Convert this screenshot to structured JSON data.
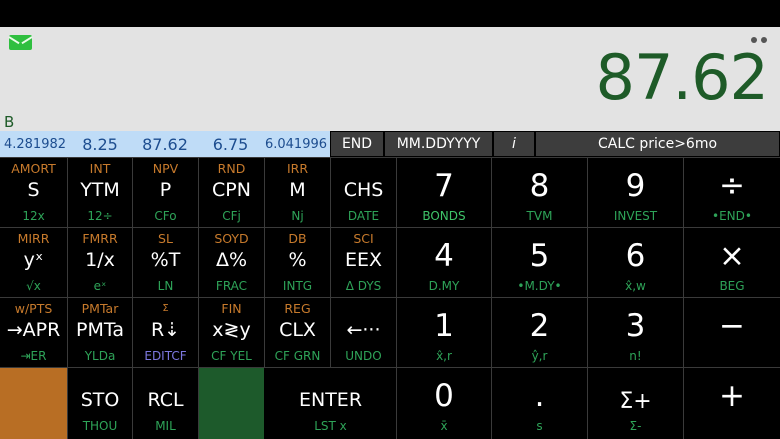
{
  "display": {
    "value": "87.62",
    "mode": "B",
    "message_icon": "envelope-icon",
    "menu_icon": "more-dots-icon"
  },
  "status": {
    "registers": [
      "4.281982",
      "8.25",
      "87.62",
      "6.75",
      "6.041996"
    ],
    "end_mode": "END",
    "date_format": "MM.DDYYYY",
    "i_label": "i",
    "calc_label": "CALC price>6mo"
  },
  "keys": {
    "amort": {
      "top": "AMORT",
      "main": "S",
      "bottom": "12x"
    },
    "int": {
      "top": "INT",
      "main": "YTM",
      "bottom": "12÷"
    },
    "npv": {
      "top": "NPV",
      "main": "P",
      "bottom": "CFo"
    },
    "rnd": {
      "top": "RND",
      "main": "CPN",
      "bottom": "CFj"
    },
    "irr": {
      "top": "IRR",
      "main": "M",
      "bottom": "Nj"
    },
    "chs": {
      "main": "CHS",
      "bottom": "DATE"
    },
    "seven": {
      "main": "7",
      "bottom": "BONDS"
    },
    "eight": {
      "main": "8",
      "bottom": "TVM"
    },
    "nine": {
      "main": "9",
      "bottom": "INVEST"
    },
    "divide": {
      "main": "÷",
      "bottom": "•END•"
    },
    "mirr": {
      "top": "MIRR",
      "main": "yˣ",
      "bottom": "√x"
    },
    "fmrr": {
      "top": "FMRR",
      "main": "1/x",
      "bottom": "eˣ"
    },
    "sl": {
      "top": "SL",
      "main": "%T",
      "bottom": "LN"
    },
    "soyd": {
      "top": "SOYD",
      "main": "Δ%",
      "bottom": "FRAC"
    },
    "db": {
      "top": "DB",
      "main": "%",
      "bottom": "INTG"
    },
    "sci": {
      "top": "SCI",
      "main": "EEX",
      "bottom": "Δ DYS"
    },
    "four": {
      "main": "4",
      "bottom": "D.MY"
    },
    "five": {
      "main": "5",
      "bottom": "•M.DY•"
    },
    "six": {
      "main": "6",
      "bottom": "x̂,w"
    },
    "multiply": {
      "main": "×",
      "bottom": "BEG"
    },
    "wpts": {
      "top": "w/PTS",
      "main": "→APR",
      "bottom": "⇥ER"
    },
    "pmtar": {
      "top": "PMTar",
      "main": "PMTa",
      "bottom": "YLDa"
    },
    "sigma_top": {
      "top": "Σ",
      "main": "R⇣",
      "bottom": "EDITCF"
    },
    "fin": {
      "top": "FIN",
      "main": "x≷y",
      "bottom": "CF YEL"
    },
    "reg": {
      "top": "REG",
      "main": "CLX",
      "bottom": "CF GRN"
    },
    "undo": {
      "main": "←···",
      "bottom": "UNDO"
    },
    "one": {
      "main": "1",
      "bottom": "x̂,r"
    },
    "two": {
      "main": "2",
      "bottom": "ŷ,r"
    },
    "three": {
      "main": "3",
      "bottom": "n!"
    },
    "minus": {
      "main": "−",
      "bottom": ""
    },
    "sto": {
      "main": "STO",
      "bottom": "THOU"
    },
    "rcl": {
      "main": "RCL",
      "bottom": "MIL"
    },
    "enter": {
      "main": "ENTER",
      "bottom": "LST x"
    },
    "zero": {
      "main": "0",
      "bottom": "x̄"
    },
    "point": {
      "main": ".",
      "bottom": "s"
    },
    "sigma_plus": {
      "main": "Σ+",
      "bottom": "Σ-"
    },
    "plus": {
      "main": "+",
      "bottom": ""
    }
  },
  "colors": {
    "display_bg": "#e3e3e3",
    "display_text": "#1e5b28",
    "register_bg": "#bfdcf7",
    "register_text": "#1d4d8f",
    "f_key": "#b86e24",
    "g_key": "#1d5a2b",
    "gold_label": "#c77a2c",
    "green_label": "#2ea358",
    "purple_label": "#7d78e0"
  }
}
